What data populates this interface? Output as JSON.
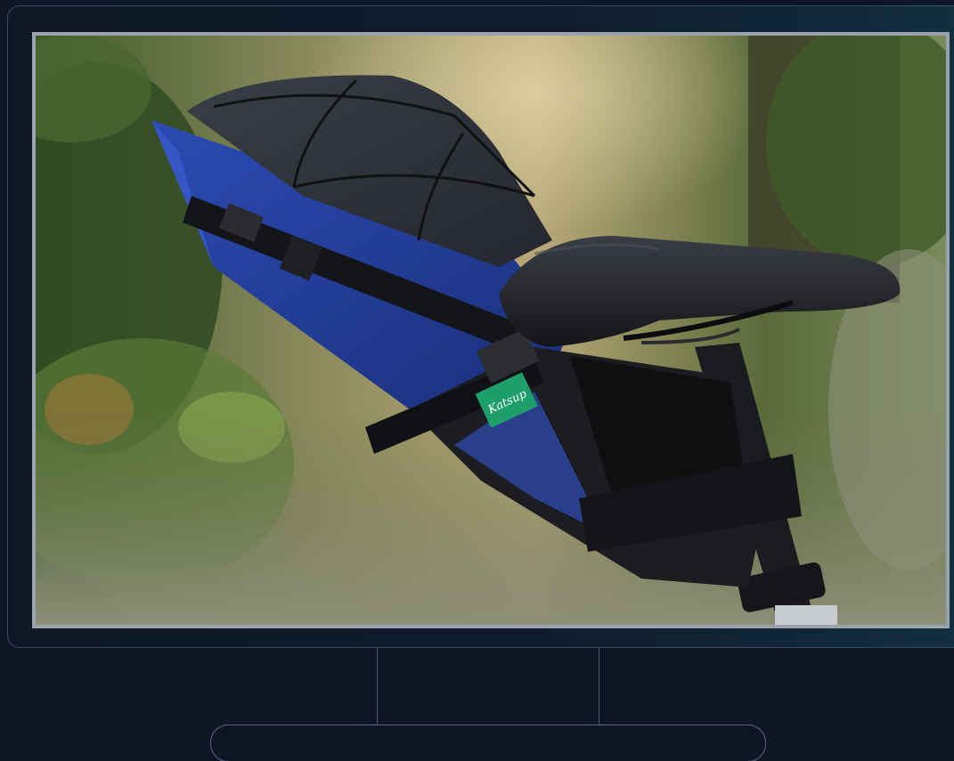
{
  "photo": {
    "subject": "",
    "label_text": "Katsup"
  },
  "colors": {
    "background": "#0d1624",
    "bezel_border": "#3a4a5e",
    "screen_frame": "#9aa3ad",
    "bag_blue": "#233f9a",
    "bag_grey": "#2e3138",
    "saddle": "#1c1e22",
    "label_green": "#1e9e6a"
  }
}
